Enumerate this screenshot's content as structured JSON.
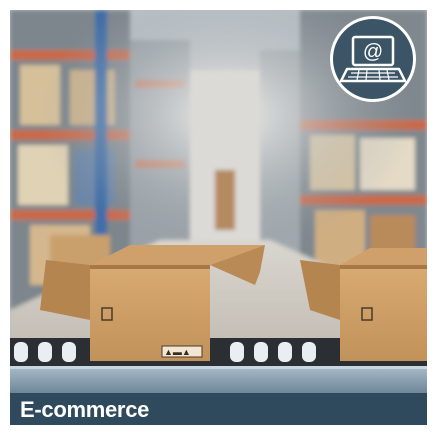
{
  "category": {
    "label": "E-commerce",
    "icon": "laptop-email-icon"
  },
  "colors": {
    "caption_bar": "#2f4a5c",
    "badge": "#3b5566",
    "box": "#c89a62",
    "conveyor": "#8fa6b8"
  }
}
